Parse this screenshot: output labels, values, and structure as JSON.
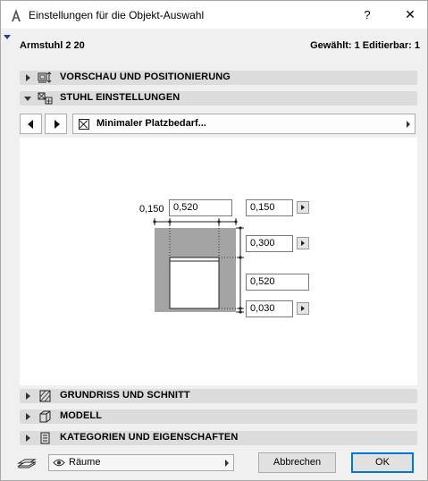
{
  "window": {
    "title": "Einstellungen für die Objekt-Auswahl",
    "help_label": "?",
    "close_label": "✕"
  },
  "header": {
    "object_name": "Armstuhl 2 20",
    "selection_info": "Gewählt: 1 Editierbar: 1"
  },
  "panels": {
    "preview": "VORSCHAU UND POSITIONIERUNG",
    "chair": "STUHL EINSTELLUNGEN",
    "floorplan": "GRUNDRISS UND SCHNITT",
    "model": "MODELL",
    "categories": "KATEGORIEN UND EIGENSCHAFTEN"
  },
  "page_selector": {
    "label": "Minimaler Platzbedarf..."
  },
  "dimensions": {
    "left_static": "0,150",
    "top_width": "0,520",
    "right_top": "0,150",
    "front_depth": "0,300",
    "seat_depth": "0,520",
    "back_depth": "0,030"
  },
  "footer": {
    "layer": "Räume",
    "cancel": "Abbrechen",
    "ok": "OK"
  },
  "icons": {
    "app": "archicad-logo-icon",
    "help": "help-icon",
    "close": "close-icon",
    "layer": "layer-stack-icon",
    "eye": "eye-icon"
  }
}
